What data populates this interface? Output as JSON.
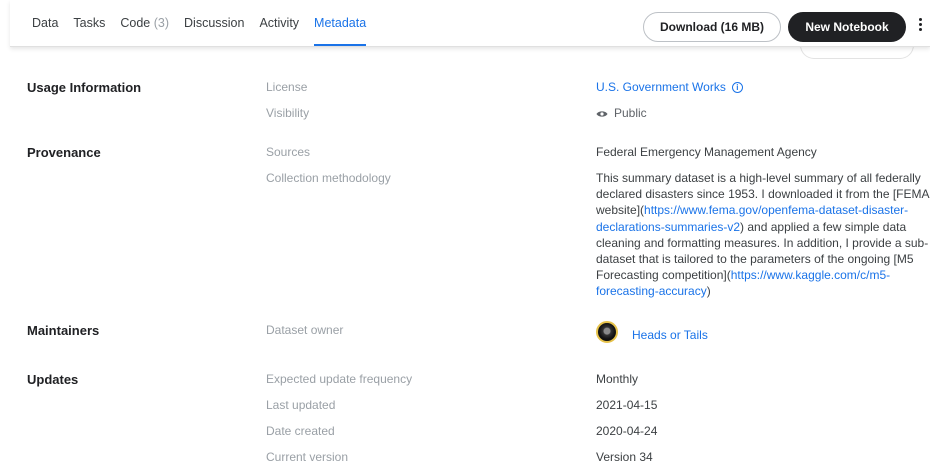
{
  "tabs": [
    {
      "label": "Data"
    },
    {
      "label": "Tasks"
    },
    {
      "label": "Code",
      "count": "(3)"
    },
    {
      "label": "Discussion"
    },
    {
      "label": "Activity"
    },
    {
      "label": "Metadata",
      "active": true
    }
  ],
  "toolbar": {
    "download_label": "Download (16 MB)",
    "new_notebook_label": "New Notebook"
  },
  "usage": {
    "title": "Usage Information",
    "license_label": "License",
    "license_value": "U.S. Government Works",
    "visibility_label": "Visibility",
    "visibility_value": "Public"
  },
  "provenance": {
    "title": "Provenance",
    "sources_label": "Sources",
    "sources_value": "Federal Emergency Management Agency",
    "methodology_label": "Collection methodology",
    "methodology_parts": [
      "This summary dataset is a high-level summary of all federally declared disasters since 1953. I downloaded it from the [FEMA website](",
      "https://www.fema.gov/openfema-dataset-disaster-declarations-summaries-v2",
      ") and applied a few simple data cleaning and formatting measures. In addition, I provide a sub-dataset that is tailored to the parameters of the ongoing [M5 Forecasting competition](",
      "https://www.kaggle.com/c/m5-forecasting-accuracy",
      ")"
    ]
  },
  "maintainers": {
    "title": "Maintainers",
    "owner_label": "Dataset owner",
    "owner_name": "Heads or Tails"
  },
  "updates": {
    "title": "Updates",
    "frequency_label": "Expected update frequency",
    "frequency_value": "Monthly",
    "last_updated_label": "Last updated",
    "last_updated_value": "2021-04-15",
    "created_label": "Date created",
    "created_value": "2020-04-24",
    "version_label": "Current version",
    "version_value": "Version 34"
  },
  "colors": {
    "accent": "#1a73e8",
    "dark_button": "#202124",
    "label_gray": "#9aa0a6"
  }
}
